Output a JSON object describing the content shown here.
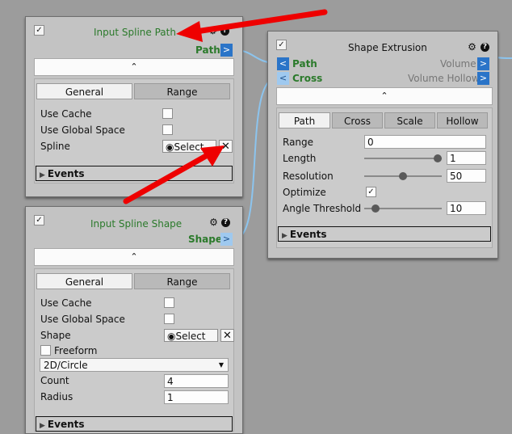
{
  "node_path": {
    "title": "Input Spline Path",
    "enabled": "✓",
    "out_port": "Path",
    "out_arrow": ">",
    "collapse": "⌃",
    "tabs": [
      "General",
      "Range"
    ],
    "use_cache": "Use Cache",
    "use_global": "Use Global Space",
    "spline": "Spline",
    "select_label": "Select",
    "select_icon": "◉",
    "clear_icon": "✕",
    "events": "Events",
    "events_tri": "▶"
  },
  "node_shape": {
    "title": "Input Spline Shape",
    "enabled": "✓",
    "out_port": "Shape",
    "out_arrow": ">",
    "collapse": "⌃",
    "tabs": [
      "General",
      "Range"
    ],
    "use_cache": "Use Cache",
    "use_global": "Use Global Space",
    "shape": "Shape",
    "select_label": "Select",
    "select_icon": "◉",
    "clear_icon": "✕",
    "freeform": "Freeform",
    "dropdown_value": "2D/Circle",
    "dropdown_caret": "▼",
    "count_label": "Count",
    "count_value": "4",
    "radius_label": "Radius",
    "radius_value": "1",
    "events": "Events",
    "events_tri": "▶"
  },
  "node_extrusion": {
    "title": "Shape Extrusion",
    "enabled": "✓",
    "in_arrow": "<",
    "out_arrow": ">",
    "in_path": "Path",
    "in_cross": "Cross",
    "out_volume": "Volume",
    "out_volume_hollow": "Volume Hollow",
    "collapse": "⌃",
    "tabs": [
      "Path",
      "Cross",
      "Scale",
      "Hollow"
    ],
    "range_label": "Range",
    "range_value": "0",
    "length_label": "Length",
    "length_value": "1",
    "length_slider_fraction": 1.0,
    "resolution_label": "Resolution",
    "resolution_value": "50",
    "resolution_slider_fraction": 0.5,
    "optimize_label": "Optimize",
    "optimize_check": "✓",
    "angle_label": "Angle Threshold",
    "angle_value": "10",
    "angle_slider_fraction": 0.1,
    "events": "Events",
    "events_tri": "▶"
  },
  "icons": {
    "gear": "⚙",
    "help": "?"
  },
  "colors": {
    "port_active": "#2a74c8",
    "port_inactive": "#9fc9ef",
    "title_green": "#2b7a2b",
    "annotation_arrow": "#ee0000"
  }
}
